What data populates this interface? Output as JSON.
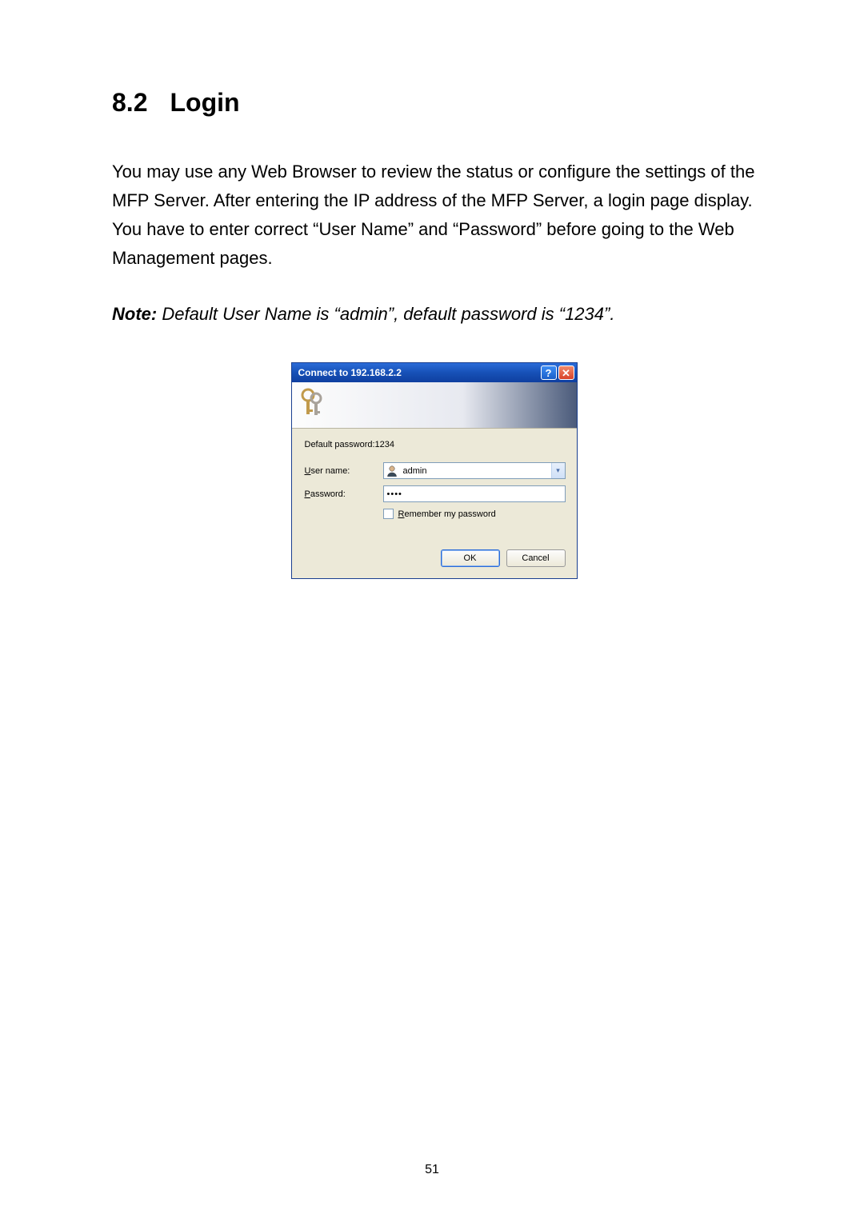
{
  "heading": {
    "number": "8.2",
    "title": "Login"
  },
  "paragraph": "You may use any Web Browser to review the status or configure the settings of the MFP Server. After entering the IP address of the MFP Server, a login page display. You have to enter correct “User Name” and “Password” before going to the Web Management pages.",
  "note": {
    "label": "Note:",
    "text": " Default User Name is “admin”, default password is “1234”."
  },
  "dialog": {
    "title": "Connect to 192.168.2.2",
    "realm": "Default password:1234",
    "username": {
      "label_prefix": "U",
      "label_rest": "ser name:",
      "value": "admin"
    },
    "password": {
      "label_prefix": "P",
      "label_rest": "assword:",
      "masked": "••••"
    },
    "remember": {
      "label_prefix": "R",
      "label_rest": "emember my password"
    },
    "ok": "OK",
    "cancel": "Cancel"
  },
  "page_number": "51"
}
